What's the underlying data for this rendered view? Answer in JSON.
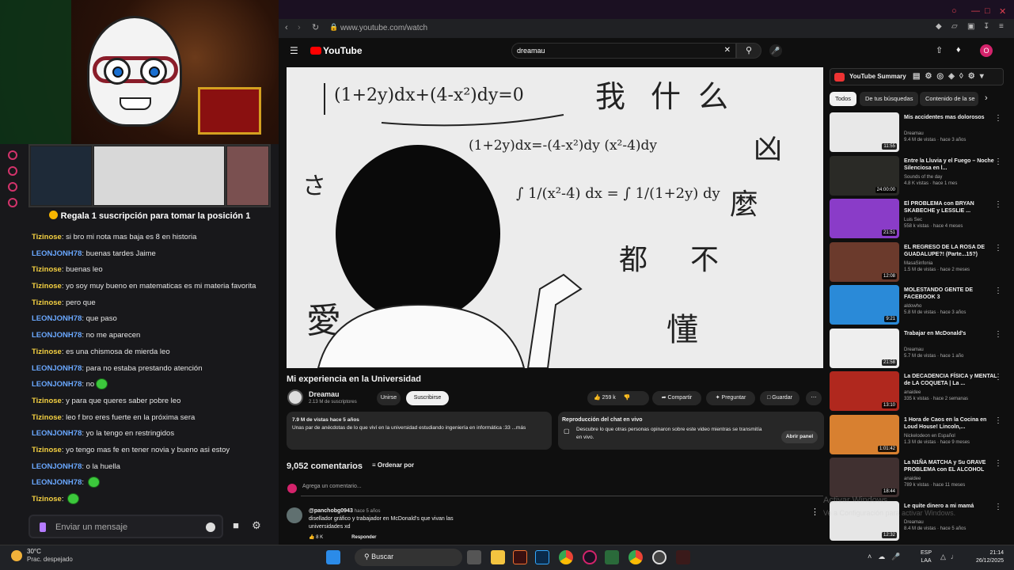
{
  "stream": {
    "pinned_message": "Regala 1 suscripción para tomar la posición 1",
    "chat": [
      {
        "user": "Tizinose",
        "text": "si bro mi nota mas baja es 8 en historia",
        "color": "yellow"
      },
      {
        "user": "LEONJONH78",
        "text": "buenas tardes Jaime",
        "color": "blue"
      },
      {
        "user": "Tizinose",
        "text": "buenas leo",
        "color": "yellow"
      },
      {
        "user": "Tizinose",
        "text": "yo soy muy bueno en matematicas es mi materia favorita",
        "color": "yellow"
      },
      {
        "user": "Tizinose",
        "text": "pero que",
        "color": "yellow"
      },
      {
        "user": "LEONJONH78",
        "text": "que paso",
        "color": "blue"
      },
      {
        "user": "LEONJONH78",
        "text": "no me aparecen",
        "color": "blue"
      },
      {
        "user": "Tizinose",
        "text": "es una chismosa de mierda leo",
        "color": "yellow"
      },
      {
        "user": "LEONJONH78",
        "text": "para no estaba prestando atención",
        "color": "blue"
      },
      {
        "user": "LEONJONH78",
        "text": "no",
        "color": "blue",
        "emote": true
      },
      {
        "user": "Tizinose",
        "text": "y para que queres saber pobre leo",
        "color": "yellow"
      },
      {
        "user": "Tizinose",
        "text": "leo f bro eres fuerte en la próxima sera",
        "color": "yellow"
      },
      {
        "user": "LEONJONH78",
        "text": "yo la tengo en restringidos",
        "color": "blue"
      },
      {
        "user": "Tizinose",
        "text": "yo tengo mas fe en tener novia y bueno asi estoy",
        "color": "yellow"
      },
      {
        "user": "LEONJONH78",
        "text": "o la huella",
        "color": "blue"
      },
      {
        "user": "LEONJONH78",
        "text": "",
        "color": "blue",
        "emote": true
      },
      {
        "user": "Tizinose",
        "text": "",
        "color": "yellow",
        "emote": true
      }
    ],
    "chat_input_placeholder": "Enviar un mensaje"
  },
  "browser": {
    "url": "www.youtube.com/watch"
  },
  "youtube": {
    "logo": "YouTube",
    "search_value": "dreamau",
    "avatar_letter": "O",
    "video": {
      "title": "Mi experiencia en la Universidad",
      "channel": "Dreamau",
      "subscribers": "2.13 M de suscriptores",
      "join_label": "Unirse",
      "subscribe_label": "Suscribirse",
      "likes": "259 k",
      "share_label": "Compartir",
      "ask_label": "Preguntar",
      "save_label": "Guardar",
      "views_date": "7.9 M de vistas  hace 5 años",
      "description": "Unas par de anécdotas de lo que viví en la universidad estudiando ingeniería en informática :33 ...más",
      "equation_top": "(1+2y)dx+(4-x²)dy=0",
      "equation_mid": "(1+2y)dx=-(4-x²)dy (x²-4)dy"
    },
    "live_chat": {
      "title": "Reproducción del chat en vivo",
      "text": "Descubre lo que otras personas opinaron sobre este video mientras se transmitía en vivo.",
      "button": "Abrir panel"
    },
    "comments": {
      "count": "9,052 comentarios",
      "sort_label": "Ordenar por",
      "add_placeholder": "Agrega un comentario...",
      "first": {
        "user": "@panchobg0943",
        "time": "hace 5 años",
        "text": "disellador gráfico y trabajador en McDonald's que vivan las universidades xd",
        "likes": "8 K",
        "reply_label": "Responder"
      }
    },
    "sidebar": {
      "summary_title": "YouTube Summary",
      "chips": [
        "Todos",
        "De tus búsquedas",
        "Contenido de la se"
      ],
      "recommendations": [
        {
          "title": "Mis accidentes mas dolorosos",
          "channel": "Dreamau",
          "meta": "9.4 M de vistas · hace 3 años",
          "duration": "11:55",
          "color": "#e8e8e8"
        },
        {
          "title": "Entre la Lluvia y el Fuego – Noche Silenciosa en l...",
          "channel": "Sounds of the day",
          "meta": "4.8 K vistas · hace 1 mes",
          "duration": "24:00:00",
          "color": "#2a2a26"
        },
        {
          "title": "El PROBLEMA con BRYAN SKABECHE y LESSLIE ...",
          "channel": "Luis Sec",
          "meta": "558 k vistas · hace 4 meses",
          "duration": "21:51",
          "color": "#8a3cc8"
        },
        {
          "title": "EL REGRESO DE LA ROSA DE GUADALUPE?! (Parte...15?)",
          "channel": "MasaSinfonia",
          "meta": "1.5 M de vistas · hace 2 meses",
          "duration": "12:08",
          "color": "#6b3a2c"
        },
        {
          "title": "MOLESTANDO GENTE DE FACEBOOK 3",
          "channel": "aldowho",
          "meta": "5.8 M de vistas · hace 3 años",
          "duration": "9:21",
          "color": "#2a8ad8"
        },
        {
          "title": "Trabajar en McDonald's",
          "channel": "Dreamau",
          "meta": "5.7 M de vistas · hace 1 año",
          "duration": "21:58",
          "color": "#eeeeee"
        },
        {
          "title": "La DECADENCIA FÍSICA y MENTAL de LA COQUETA | La ...",
          "channel": "anaidee",
          "meta": "335 k vistas · hace 2 semanas",
          "duration": "13:10",
          "color": "#b0281e"
        },
        {
          "title": "1 Hora de Caos en la Cocina en Loud House! Lincoln,...",
          "channel": "Nickelodeon en Español",
          "meta": "1.3 M de vistas · hace 9 meses",
          "duration": "1:01:42",
          "color": "#d88030"
        },
        {
          "title": "La N1ÑA MATCHA y Su GRAVE PROBLEMA con EL ALCOHOL",
          "channel": "anaidee",
          "meta": "789 k vistas · hace 11 meses",
          "duration": "18:44",
          "color": "#403030"
        },
        {
          "title": "Le quite dinero a mi mamá",
          "channel": "Dreamau",
          "meta": "8.4 M de vistas · hace 5 años",
          "duration": "12:32",
          "color": "#e6e6e6"
        }
      ]
    }
  },
  "watermark": {
    "line1": "Activar Windows",
    "line2": "Ve a Configuración para activar Windows."
  },
  "taskbar": {
    "temp": "30°C",
    "weather": "Prac. despejado",
    "search": "Buscar",
    "lang": "ESP",
    "lang2": "LAA",
    "time": "21:14",
    "date": "26/12/2025"
  }
}
